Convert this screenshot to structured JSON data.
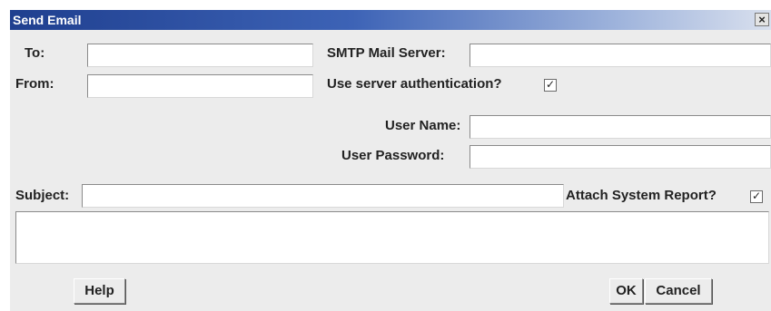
{
  "window": {
    "title": "Send Email",
    "close_glyph": "×"
  },
  "form": {
    "to_label": "To:",
    "to_value": "",
    "from_label": "From:",
    "from_value": "",
    "smtp_label": "SMTP Mail Server:",
    "smtp_value": "",
    "auth_label": "Use server authentication?",
    "auth_checked": true,
    "username_label": "User Name:",
    "username_value": "",
    "password_label": "User Password:",
    "password_value": "",
    "subject_label": "Subject:",
    "subject_value": "",
    "attach_label": "Attach System Report?",
    "attach_checked": true,
    "body_value": "",
    "check_glyph": "✓"
  },
  "buttons": {
    "help": "Help",
    "ok": "OK",
    "cancel": "Cancel"
  },
  "colors": {
    "titlebar_start": "#1f3f8f",
    "titlebar_end": "#d9e0ee",
    "dialog_bg": "#ececec"
  }
}
